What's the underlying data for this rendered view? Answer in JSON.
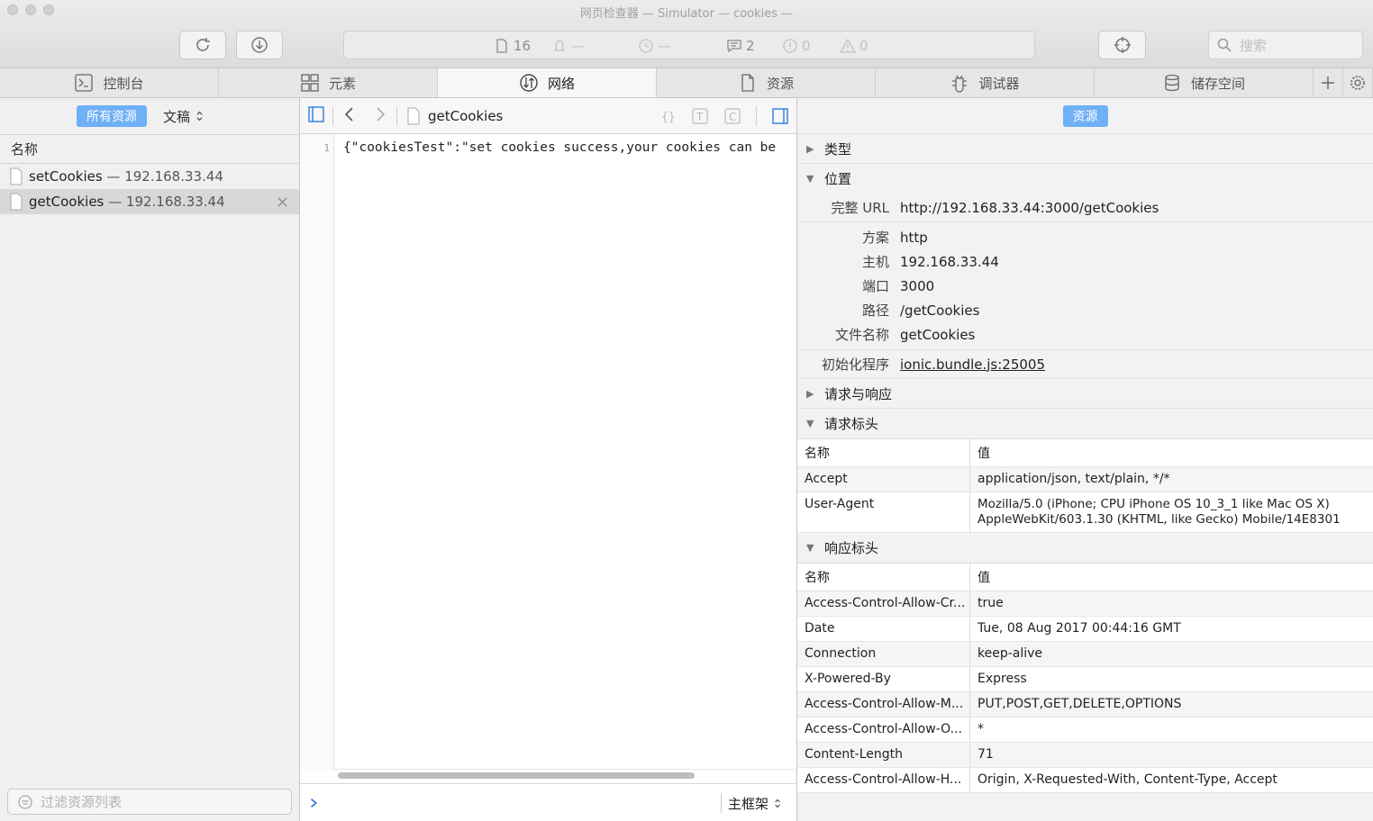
{
  "window": {
    "title": "网页检查器 — Simulator — cookies —"
  },
  "toolbar": {
    "resource_count": "16",
    "network_dash": "—",
    "time_dash": "—",
    "log_count": "2",
    "error_count": "0",
    "warning_count": "0",
    "search_placeholder": "搜索"
  },
  "tabs": [
    {
      "label": "控制台",
      "icon": "console-icon"
    },
    {
      "label": "元素",
      "icon": "elements-icon"
    },
    {
      "label": "网络",
      "icon": "network-icon"
    },
    {
      "label": "资源",
      "icon": "document-icon"
    },
    {
      "label": "调试器",
      "icon": "debugger-icon"
    },
    {
      "label": "储存空间",
      "icon": "storage-icon"
    }
  ],
  "sidebar": {
    "scope_all": "所有资源",
    "scope_doc": "文稿",
    "column_name": "名称",
    "resources": [
      {
        "name": "setCookies",
        "host": " — 192.168.33.44"
      },
      {
        "name": "getCookies",
        "host": " — 192.168.33.44"
      }
    ],
    "filter_placeholder": "过滤资源列表"
  },
  "editor": {
    "file": "getCookies",
    "line": "1",
    "content": "{\"cookiesTest\":\"set cookies success,your cookies can be",
    "frame_label": "主框架"
  },
  "details": {
    "header_pill": "资源",
    "sections": {
      "type": "类型",
      "location": "位置",
      "req_res": "请求与响应",
      "req_headers": "请求标头",
      "res_headers": "响应标头"
    },
    "location": {
      "full_url_k": "完整 URL",
      "full_url_v": "http://192.168.33.44:3000/getCookies",
      "scheme_k": "方案",
      "scheme_v": "http",
      "host_k": "主机",
      "host_v": "192.168.33.44",
      "port_k": "端口",
      "port_v": "3000",
      "path_k": "路径",
      "path_v": "/getCookies",
      "filename_k": "文件名称",
      "filename_v": "getCookies",
      "initiator_k": "初始化程序",
      "initiator_v": "ionic.bundle.js:25005"
    },
    "table_head": {
      "name": "名称",
      "value": "值"
    },
    "request_headers": [
      {
        "name": "Accept",
        "value": "application/json, text/plain, */*"
      },
      {
        "name": "User-Agent",
        "value": "Mozilla/5.0 (iPhone; CPU iPhone OS 10_3_1 like Mac OS X) AppleWebKit/603.1.30 (KHTML, like Gecko) Mobile/14E8301"
      }
    ],
    "response_headers": [
      {
        "name": "Access-Control-Allow-Cr...",
        "value": "true"
      },
      {
        "name": "Date",
        "value": "Tue, 08 Aug 2017 00:44:16 GMT"
      },
      {
        "name": "Connection",
        "value": "keep-alive"
      },
      {
        "name": "X-Powered-By",
        "value": "Express"
      },
      {
        "name": "Access-Control-Allow-M...",
        "value": "PUT,POST,GET,DELETE,OPTIONS"
      },
      {
        "name": "Access-Control-Allow-O...",
        "value": "*"
      },
      {
        "name": "Content-Length",
        "value": "71"
      },
      {
        "name": "Access-Control-Allow-H...",
        "value": "Origin, X-Requested-With, Content-Type, Accept"
      }
    ]
  },
  "colors": {
    "accent": "#6fb0f7",
    "console_prompt": "#2f7ae5"
  }
}
